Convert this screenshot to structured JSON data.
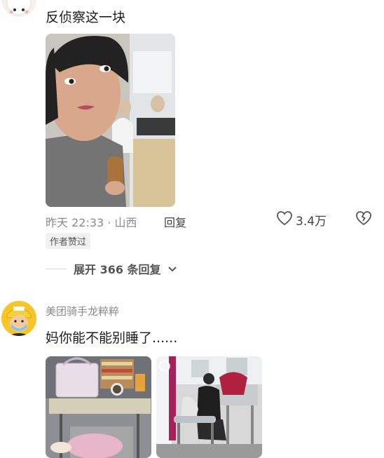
{
  "comments": [
    {
      "text": "反侦察这一块",
      "time_location": "昨天 22:33 · 山西",
      "reply_label": "回复",
      "like_count": "3.4万",
      "author_liked_badge": "作者赞过",
      "expand_replies_label": "展开 366 条回复"
    },
    {
      "username": "美团骑手龙粹粹",
      "text": "妈你能不能别睡了......"
    }
  ],
  "icons": {
    "like": "heart-outline-icon",
    "dislike": "broken-heart-icon",
    "expand": "chevron-down-icon"
  }
}
